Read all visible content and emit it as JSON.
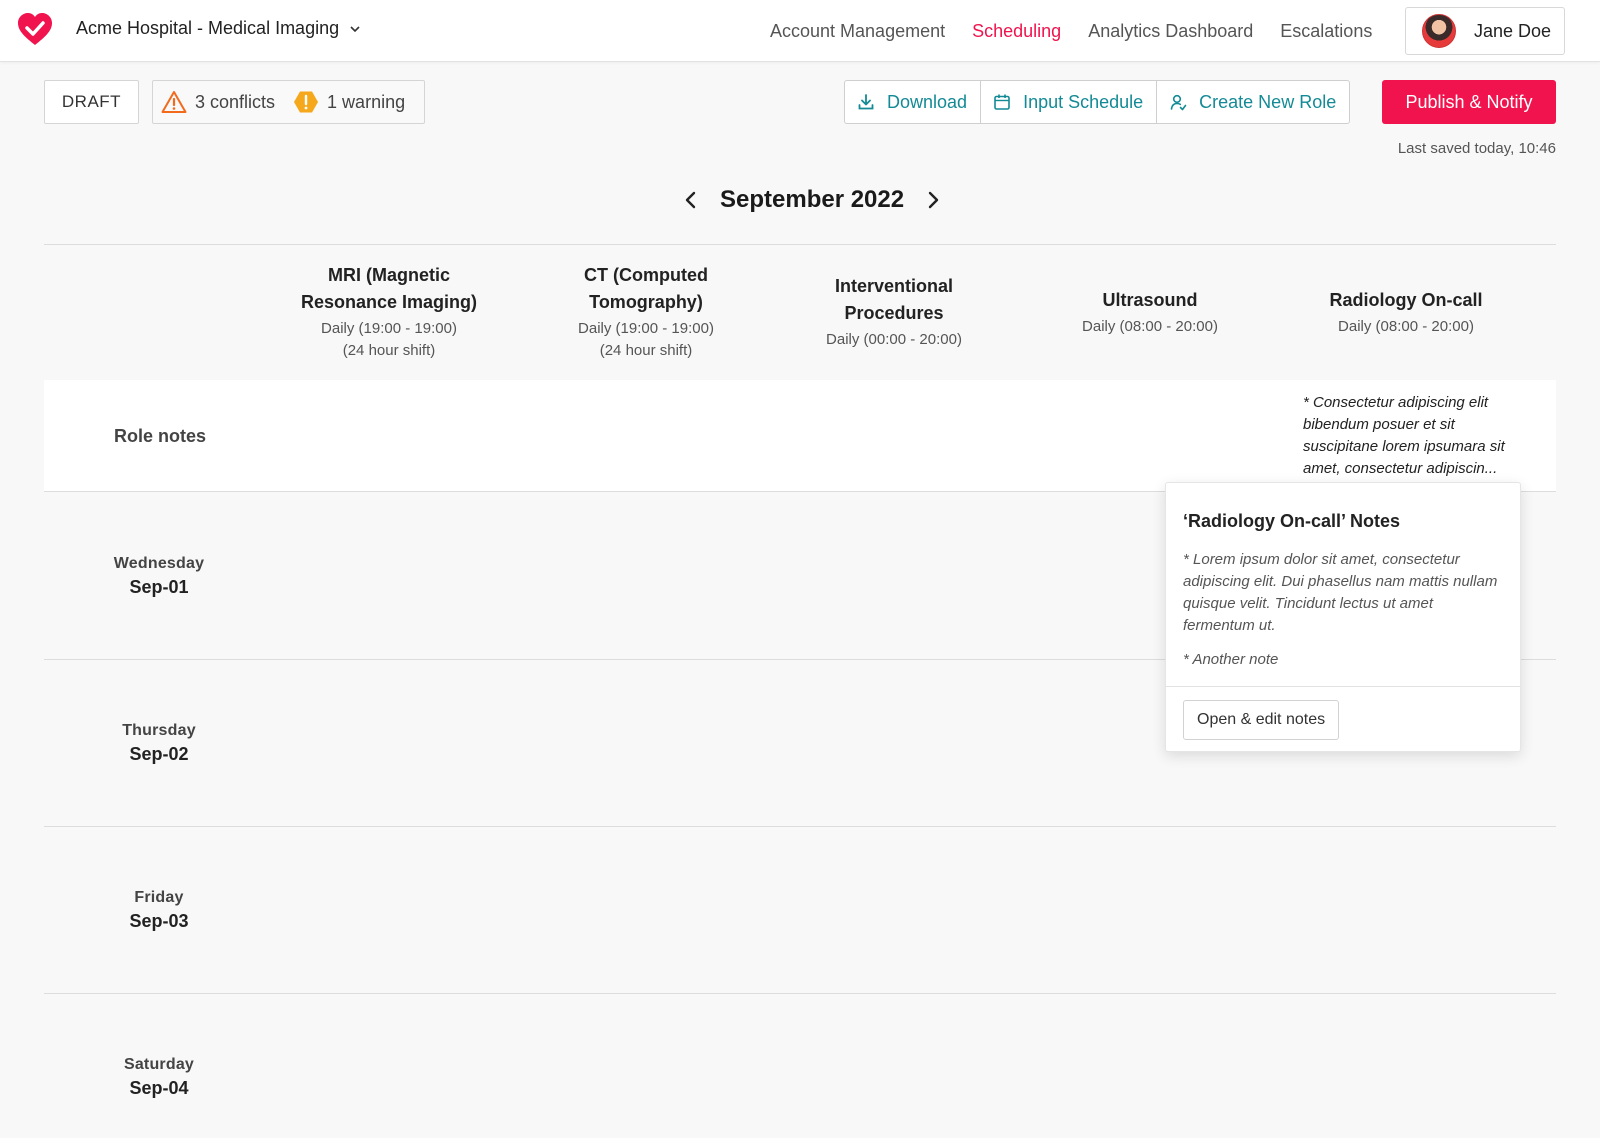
{
  "app": {
    "org_name": "Acme Hospital - Medical Imaging",
    "brand_color": "#f0134d",
    "accent_color": "#138a95"
  },
  "nav": {
    "items": [
      {
        "label": "Account Management",
        "active": false
      },
      {
        "label": "Scheduling",
        "active": true
      },
      {
        "label": "Analytics Dashboard",
        "active": false
      },
      {
        "label": "Escalations",
        "active": false
      }
    ]
  },
  "user": {
    "name": "Jane Doe"
  },
  "toolbar": {
    "status": "DRAFT",
    "conflicts": "3 conflicts",
    "warnings": "1 warning",
    "download_label": "Download",
    "input_schedule_label": "Input Schedule",
    "create_role_label": "Create New Role",
    "publish_label": "Publish & Notify",
    "last_saved": "Last saved today, 10:46"
  },
  "calendar": {
    "month": "September 2022"
  },
  "roles": [
    {
      "name_line1": "MRI (Magnetic",
      "name_line2": "Resonance Imaging)",
      "schedule_line1": "Daily (19:00 - 19:00)",
      "schedule_line2": "(24 hour shift)"
    },
    {
      "name_line1": "CT (Computed",
      "name_line2": "Tomography)",
      "schedule_line1": "Daily (19:00 - 19:00)",
      "schedule_line2": "(24 hour shift)"
    },
    {
      "name_line1": "Interventional",
      "name_line2": "Procedures",
      "schedule_line1": "Daily (00:00 - 20:00)",
      "schedule_line2": ""
    },
    {
      "name_line1": "Ultrasound",
      "name_line2": "",
      "schedule_line1": "Daily (08:00 - 20:00)",
      "schedule_line2": ""
    },
    {
      "name_line1": "Radiology On-call",
      "name_line2": "",
      "schedule_line1": "Daily (08:00 - 20:00)",
      "schedule_line2": ""
    }
  ],
  "role_notes": {
    "label": "Role notes",
    "radiology_preview": "* Consectetur adipiscing elit bibendum posuer et sit suscipitane lorem ipsumara sit amet, consectetur adipiscin..."
  },
  "days": [
    {
      "weekday": "Wednesday",
      "date": "Sep-01"
    },
    {
      "weekday": "Thursday",
      "date": "Sep-02"
    },
    {
      "weekday": "Friday",
      "date": "Sep-03"
    },
    {
      "weekday": "Saturday",
      "date": "Sep-04"
    }
  ],
  "popover": {
    "title": "‘Radiology On-call’ Notes",
    "note1": "* Lorem ipsum dolor sit amet, consectetur adipiscing elit. Dui phasellus nam mattis nullam quisque velit. Tincidunt lectus ut amet fermentum ut.",
    "note2": "* Another note",
    "button_label": "Open & edit notes"
  }
}
